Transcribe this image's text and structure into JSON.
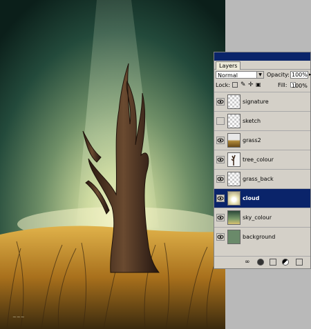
{
  "layers_panel": {
    "tab_label": "Layers",
    "blend_mode": "Normal",
    "opacity_label": "Opacity:",
    "opacity_value": "100%",
    "lock_label": "Lock:",
    "fill_label": "Fill:",
    "fill_value": "100%",
    "layers": [
      {
        "name": "signature",
        "visible": true,
        "selected": false
      },
      {
        "name": "sketch",
        "visible": false,
        "selected": false
      },
      {
        "name": "grass2",
        "visible": true,
        "selected": false
      },
      {
        "name": "tree_colour",
        "visible": true,
        "selected": false
      },
      {
        "name": "grass_back",
        "visible": true,
        "selected": false
      },
      {
        "name": "cloud",
        "visible": true,
        "selected": true
      },
      {
        "name": "sky_colour",
        "visible": true,
        "selected": false
      },
      {
        "name": "background",
        "visible": true,
        "selected": false
      }
    ]
  },
  "icons": {
    "eye": "eye-icon",
    "link": "link-icon",
    "fx": "layer-style-icon",
    "mask": "layer-mask-icon",
    "adjust": "adjustment-layer-icon",
    "group": "new-group-icon",
    "lock_transparent": "lock-transparent-icon",
    "lock_paint": "lock-paint-icon",
    "lock_move": "lock-move-icon",
    "lock_all": "lock-all-icon"
  },
  "colors": {
    "selected_row": "#0a246a",
    "panel_bg": "#d4d0c8"
  }
}
